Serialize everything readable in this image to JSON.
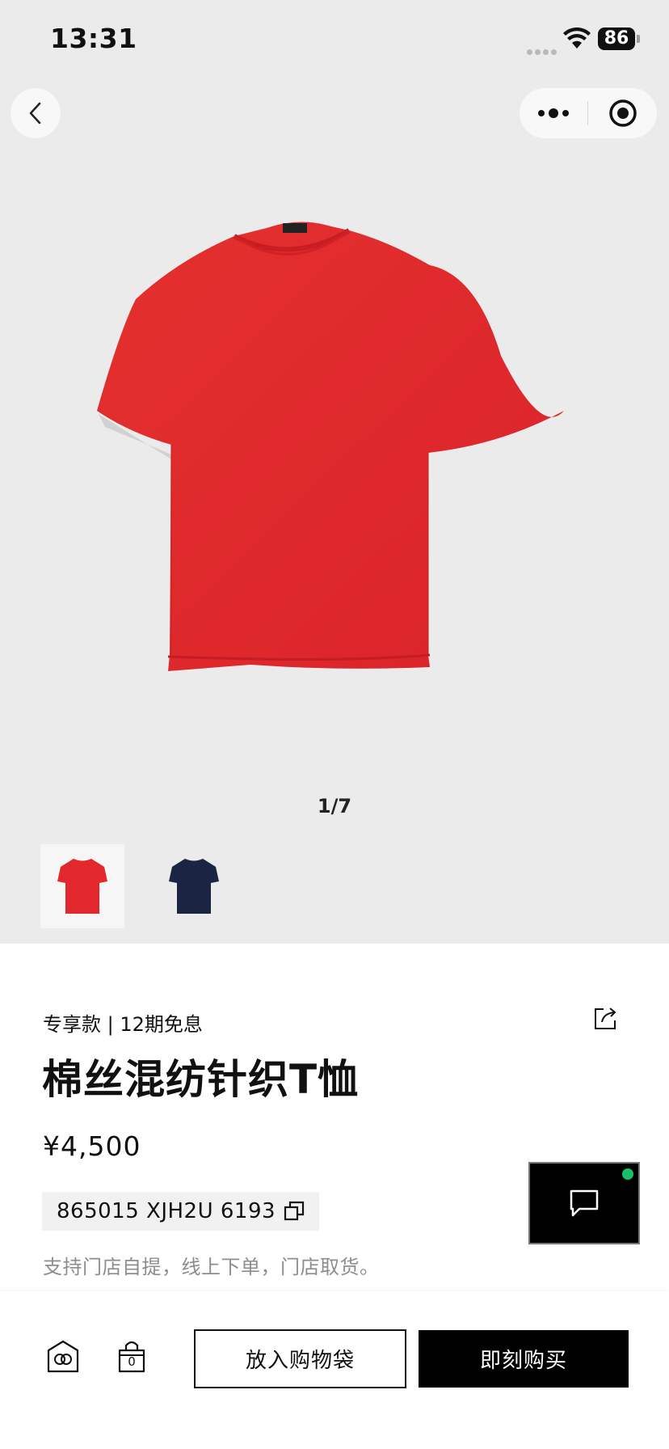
{
  "status_bar": {
    "time": "13:31",
    "battery": "86"
  },
  "gallery": {
    "counter": "1/7",
    "thumbnails": [
      {
        "color_name": "red",
        "color": "#e3282d",
        "selected": true
      },
      {
        "color_name": "navy",
        "color": "#1b2442",
        "selected": false
      }
    ],
    "product_color": "#e1272c"
  },
  "product": {
    "tag_line": "专享款 | 12期免息",
    "title": "棉丝混纺针织T恤",
    "price": "¥4,500",
    "sku": "865015 XJH2U 6193",
    "pickup_note": "支持门店自提，线上下单，门店取货。"
  },
  "bottom_bar": {
    "bag_count": "0",
    "add_to_bag_label": "放入购物袋",
    "buy_now_label": "即刻购买"
  },
  "colors": {
    "accent": "#000000",
    "online_dot": "#19c06a"
  },
  "icons": [
    "back-icon",
    "more-icon",
    "close-target-icon",
    "share-icon",
    "copy-icon",
    "chat-icon",
    "store-icon",
    "shopping-bag-icon",
    "wifi-icon"
  ]
}
